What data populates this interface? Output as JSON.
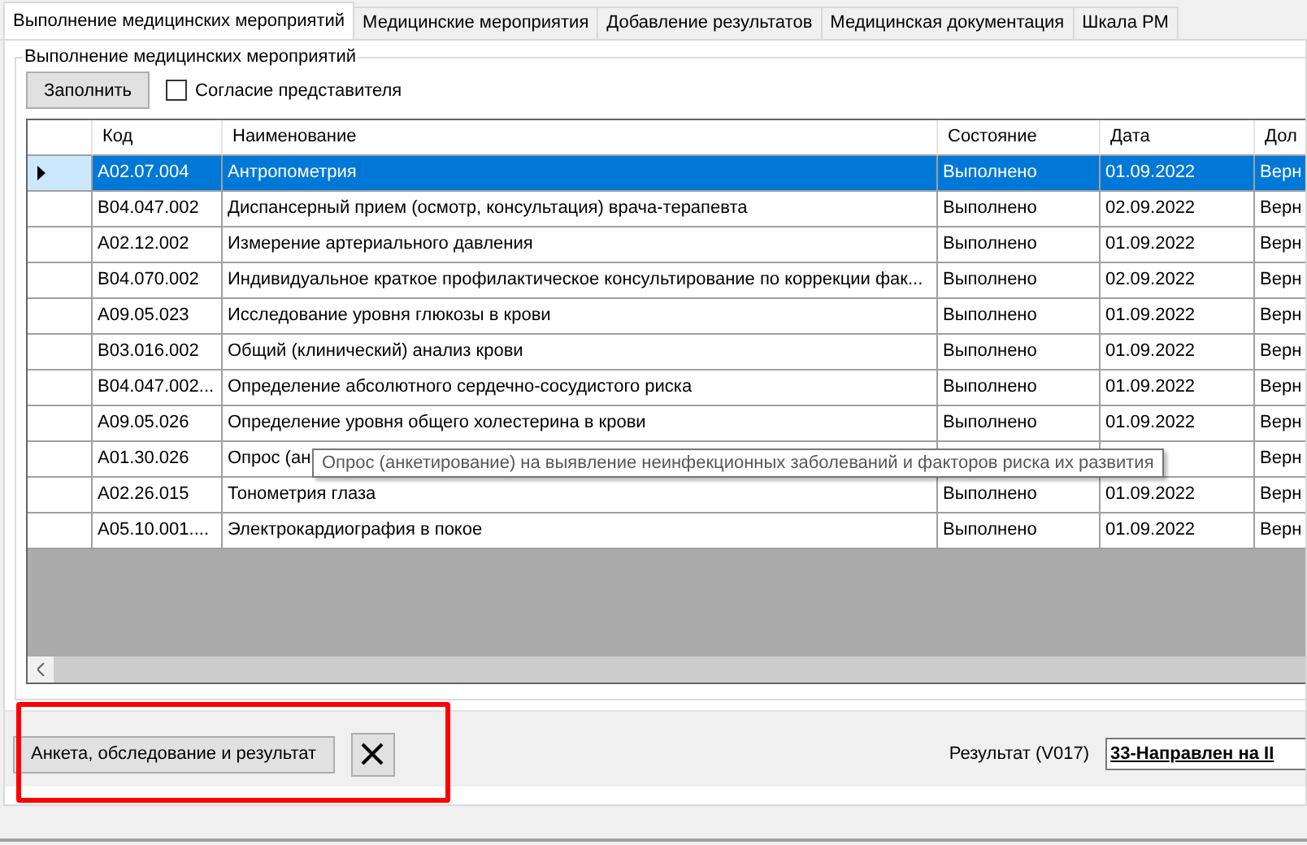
{
  "tabs": [
    {
      "label": "Выполнение медицинских мероприятий",
      "selected": true
    },
    {
      "label": "Медицинские мероприятия",
      "selected": false
    },
    {
      "label": "Добавление результатов",
      "selected": false
    },
    {
      "label": "Медицинская документация",
      "selected": false
    },
    {
      "label": "Шкала РМ",
      "selected": false
    }
  ],
  "group": {
    "title": "Выполнение медицинских мероприятий",
    "fill_button": "Заполнить",
    "consent": {
      "label": "Согласие представителя",
      "checked": false
    },
    "table": {
      "columns": [
        "Код",
        "Наименование",
        "Состояние",
        "Дата",
        "Дол"
      ],
      "rows": [
        {
          "selected": true,
          "cells": [
            "A02.07.004",
            "Антропометрия",
            "Выполнено",
            "01.09.2022",
            "Верн"
          ]
        },
        {
          "selected": false,
          "cells": [
            "B04.047.002",
            "Диспансерный прием (осмотр, консультация) врача-терапевта",
            "Выполнено",
            "02.09.2022",
            "Верн"
          ]
        },
        {
          "selected": false,
          "cells": [
            "A02.12.002",
            "Измерение артериального давления",
            "Выполнено",
            "01.09.2022",
            "Верн"
          ]
        },
        {
          "selected": false,
          "cells": [
            "B04.070.002",
            "Индивидуальное краткое профилактическое консультирование по коррекции фак...",
            "Выполнено",
            "02.09.2022",
            "Верн"
          ]
        },
        {
          "selected": false,
          "cells": [
            "A09.05.023",
            "Исследование уровня глюкозы в крови",
            "Выполнено",
            "01.09.2022",
            "Верн"
          ]
        },
        {
          "selected": false,
          "cells": [
            "B03.016.002",
            "Общий (клинический) анализ крови",
            "Выполнено",
            "01.09.2022",
            "Верн"
          ]
        },
        {
          "selected": false,
          "cells": [
            "B04.047.002...",
            "Определение абсолютного сердечно-сосудистого риска",
            "Выполнено",
            "01.09.2022",
            "Верн"
          ]
        },
        {
          "selected": false,
          "cells": [
            "A09.05.026",
            "Определение уровня общего холестерина в крови",
            "Выполнено",
            "01.09.2022",
            "Верн"
          ]
        },
        {
          "selected": false,
          "cells": [
            "A01.30.026",
            "Опрос (ан",
            "",
            "",
            "Верн"
          ]
        },
        {
          "selected": false,
          "cells": [
            "A02.26.015",
            "Тонометрия глаза",
            "Выполнено",
            "01.09.2022",
            "Верн"
          ]
        },
        {
          "selected": false,
          "cells": [
            "A05.10.001....",
            "Электрокардиография в покое",
            "Выполнено",
            "01.09.2022",
            "Верн"
          ]
        }
      ]
    },
    "tooltip": "Опрос (анкетирование) на выявление неинфекционных заболеваний и факторов риска их развития"
  },
  "footer": {
    "survey_button": "Анкета, обследование и результат",
    "result_label": "Результат (V017)",
    "result_value": "33-Направлен на II"
  }
}
